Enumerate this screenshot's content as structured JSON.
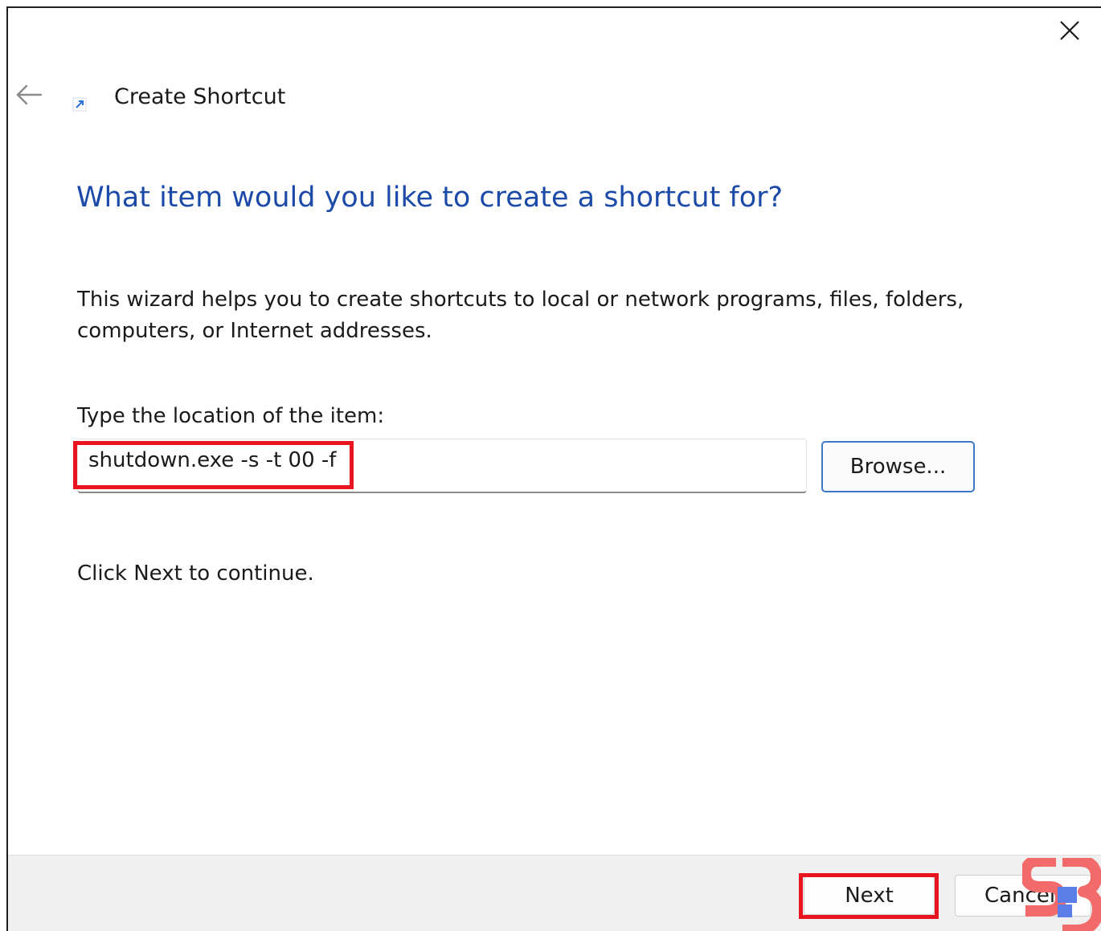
{
  "window": {
    "title": "Create Shortcut"
  },
  "wizard": {
    "heading": "What item would you like to create a shortcut for?",
    "description": "This wizard helps you to create shortcuts to local or network programs, files, folders, computers, or Internet addresses.",
    "location_label": "Type the location of the item:",
    "location_value": "shutdown.exe -s -t 00 -f",
    "browse_label": "Browse...",
    "continue_hint": "Click Next to continue."
  },
  "footer": {
    "next_label": "Next",
    "cancel_label": "Cancel"
  },
  "icons": {
    "close": "close-icon",
    "back": "back-arrow-icon",
    "shortcut": "shortcut-arrow-icon"
  },
  "colors": {
    "heading": "#1c4aa8",
    "highlight": "#e8141e",
    "browse_border": "#3d78c8",
    "footer_bg": "#f0f0f0"
  }
}
